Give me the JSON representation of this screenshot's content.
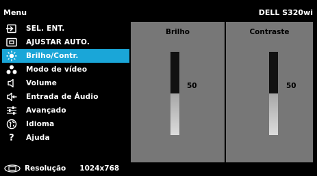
{
  "header": {
    "menu_label": "Menu",
    "model": "DELL S320wi"
  },
  "sidebar": {
    "items": [
      {
        "label": "SEL. ENT.",
        "icon": "input-source-icon",
        "selected": false
      },
      {
        "label": "AJUSTAR AUTO.",
        "icon": "auto-adjust-icon",
        "selected": false
      },
      {
        "label": "Brilho/Contr.",
        "icon": "brightness-icon",
        "selected": true
      },
      {
        "label": "Modo de vídeo",
        "icon": "video-mode-icon",
        "selected": false
      },
      {
        "label": "Volume",
        "icon": "speaker-icon",
        "selected": false
      },
      {
        "label": "Entrada de Áudio",
        "icon": "audio-input-icon",
        "selected": false
      },
      {
        "label": "Avançado",
        "icon": "sliders-icon",
        "selected": false
      },
      {
        "label": "Idioma",
        "icon": "globe-icon",
        "selected": false
      },
      {
        "label": "Ajuda",
        "icon": "question-icon",
        "selected": false
      }
    ]
  },
  "panels": {
    "brightness": {
      "title": "Brilho",
      "value": "50",
      "level_percent": 50
    },
    "contrast": {
      "title": "Contraste",
      "value": "50",
      "level_percent": 50
    }
  },
  "footer": {
    "label": "Resolução",
    "value": "1024x768",
    "icon": "monitor-icon"
  },
  "colors": {
    "accent": "#1aa6d8",
    "panel": "#777777",
    "background": "#000000"
  }
}
